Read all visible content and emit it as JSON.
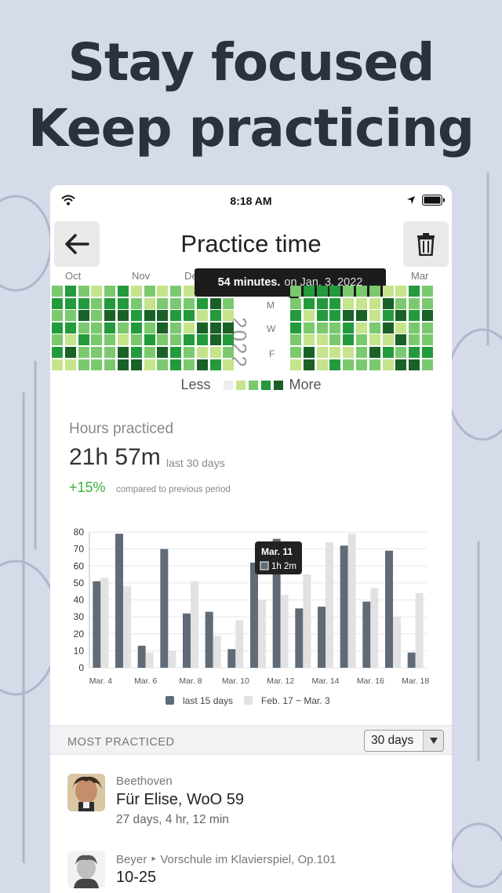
{
  "headline": {
    "line1": "Stay focused",
    "line2": "Keep practicing"
  },
  "status_bar": {
    "time": "8:18 AM"
  },
  "nav": {
    "title": "Practice time",
    "back_icon": "arrow-left-icon",
    "delete_icon": "trash-icon"
  },
  "heatmap": {
    "months": [
      "Oct",
      "Nov",
      "De",
      "Mar"
    ],
    "day_labels": [
      "M",
      "W",
      "F"
    ],
    "year": "2022",
    "tooltip_strong": "54 minutes.",
    "tooltip_rest": "on Jan. 3, 2022",
    "legend_less": "Less",
    "legend_more": "More",
    "colors": {
      "empty": "#ebedf0",
      "l1": "#c6e48b",
      "l2": "#7bc96f",
      "l3": "#239a3b",
      "l4": "#196127"
    }
  },
  "stats": {
    "title": "Hours practiced",
    "value": "21h 57m",
    "value_sub": "last 30 days",
    "change": "+15%",
    "change_sub": "compared to previous period"
  },
  "chart_data": {
    "type": "bar",
    "categories": [
      "Mar. 4",
      "Mar. 5",
      "Mar. 6",
      "Mar. 7",
      "Mar. 8",
      "Mar. 9",
      "Mar. 10",
      "Mar. 11",
      "Mar. 12",
      "Mar. 13",
      "Mar. 14",
      "Mar. 15",
      "Mar. 16",
      "Mar. 17",
      "Mar. 18"
    ],
    "tick_labels": [
      "Mar. 4",
      "Mar. 6",
      "Mar. 8",
      "Mar. 10",
      "Mar. 12",
      "Mar. 14",
      "Mar. 16",
      "Mar. 18"
    ],
    "series": [
      {
        "name": "last 15 days",
        "color": "#5f6b76",
        "values": [
          51,
          79,
          13,
          70,
          32,
          33,
          11,
          62,
          76,
          35,
          36,
          72,
          39,
          69,
          9
        ]
      },
      {
        "name": "Feb. 17 ~ Mar. 3",
        "color": "#e2e2e2",
        "values": [
          53,
          48,
          9,
          10,
          51,
          19,
          28,
          40,
          43,
          55,
          74,
          79,
          47,
          30,
          44
        ]
      }
    ],
    "ylim": [
      0,
      80
    ],
    "yticks": [
      0,
      10,
      20,
      30,
      40,
      50,
      60,
      70,
      80
    ],
    "grid": true,
    "legend_position": "bottom",
    "tooltip": {
      "title": "Mar. 11",
      "value": "1h 2m"
    }
  },
  "most_practiced": {
    "title": "MOST PRACTICED",
    "period": "30 days",
    "items": [
      {
        "composer": "Beethoven",
        "title": "Für Elise, WoO 59",
        "meta": "27 days, 4 hr, 12 min",
        "avatar_icon": "composer-portrait-icon"
      },
      {
        "composer": "Beyer ‣ Vorschule im Klavierspiel, Op.101",
        "title": "10-25",
        "meta": "",
        "avatar_icon": "composer-portrait-icon"
      }
    ]
  }
}
